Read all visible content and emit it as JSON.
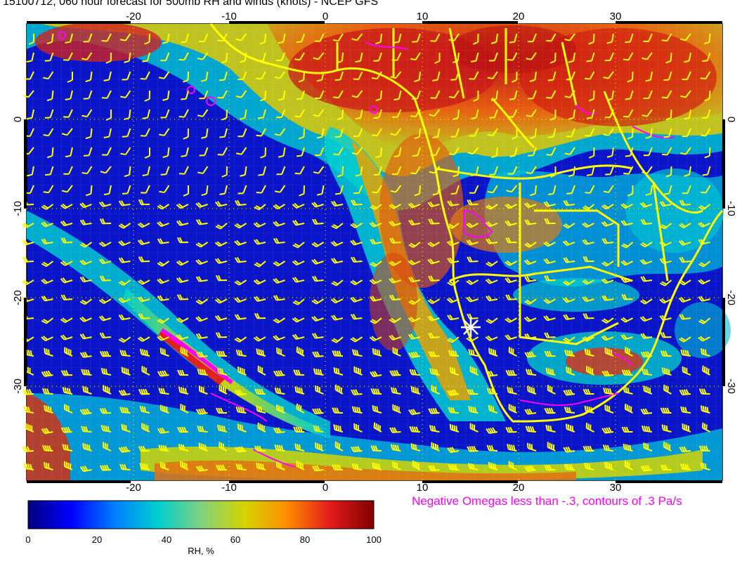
{
  "title": "15100712, 060 hour forecast for 500mb RH and winds (knots) - NCEP GFS",
  "map": {
    "lon_range": [
      -30,
      41
    ],
    "lat_range": [
      -41,
      6
    ],
    "x_ticks": [
      "-20",
      "-10",
      "0",
      "10",
      "20",
      "30"
    ],
    "x_tick_values": [
      -20,
      -10,
      0,
      10,
      20,
      30
    ],
    "y_ticks": [
      "0",
      "-10",
      "-20",
      "-30"
    ],
    "y_tick_values": [
      0,
      -10,
      -20,
      -30
    ],
    "gridlines": "dotted yellow at 10-degree intervals",
    "station_marker": "white asterisk",
    "station_lon": 15.2,
    "station_lat": -23.6,
    "colors": {
      "coastline": "#ffff00",
      "omega_contours": "#ff00ff",
      "wind_barbs": "#ffff00",
      "marker": "#ffffff"
    }
  },
  "omega_note": "Negative Omegas less than -.3, contours of .3 Pa/s",
  "omega_note_color": "#ff00ff",
  "colorbar": {
    "label": "RH, %",
    "ticks": [
      "0",
      "20",
      "40",
      "60",
      "80",
      "100"
    ],
    "tick_values": [
      0,
      20,
      40,
      60,
      80,
      100
    ],
    "stops": [
      "#00007f",
      "#0000ff",
      "#007fff",
      "#00cfcf",
      "#7fd27f",
      "#d4d400",
      "#ff8c00",
      "#e31a1c",
      "#7f0000"
    ]
  }
}
